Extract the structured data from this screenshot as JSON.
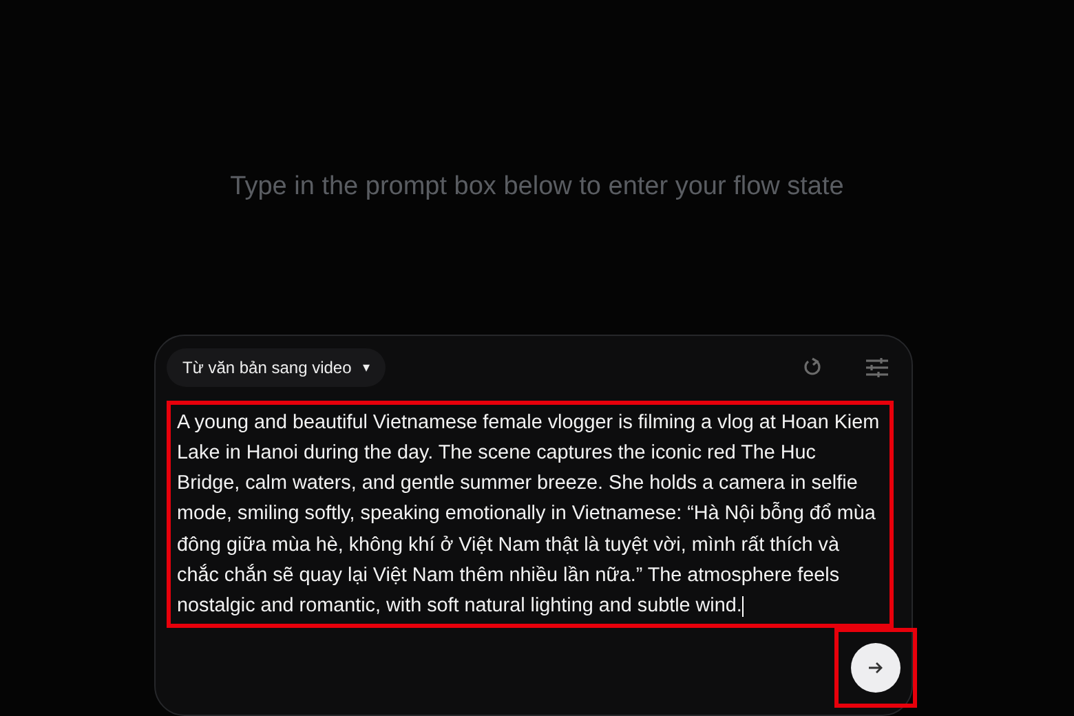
{
  "heading": "Type in the prompt box below to enter your flow state",
  "composer": {
    "mode": {
      "label": "Từ văn bản sang video",
      "caret": "▾"
    },
    "prompt": {
      "value": "A young and beautiful Vietnamese female vlogger is filming a vlog at Hoan Kiem Lake in Hanoi during the day. The scene captures the iconic red The Huc Bridge, calm waters, and gentle summer breeze. She holds a camera in selfie mode, smiling softly, speaking emotionally in Vietnamese: “Hà Nội bỗng đổ mùa đông giữa mùa hè, không khí ở Việt Nam thật là tuyệt vời, mình rất thích và chắc chắn sẽ quay lại Việt Nam thêm nhiều lần nữa.” The atmosphere feels nostalgic and romantic, with soft natural lighting and subtle wind.",
      "highlighted": true
    },
    "submit": {
      "highlighted": true
    }
  }
}
